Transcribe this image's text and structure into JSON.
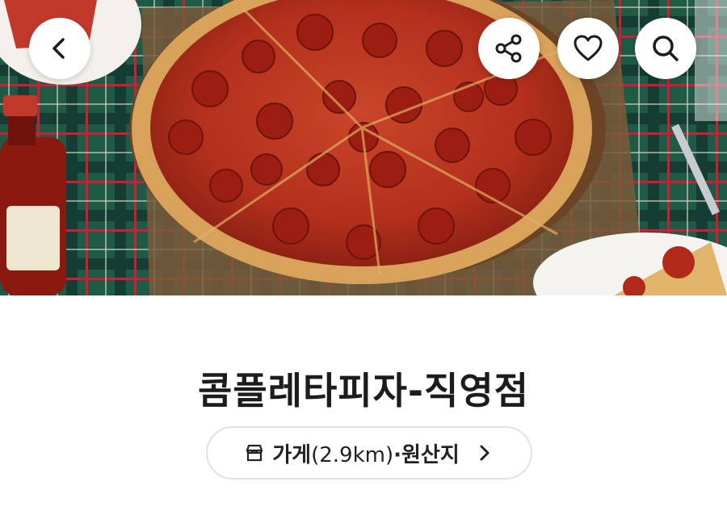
{
  "store": {
    "name": "콤플레타피자-직영점",
    "info_link": {
      "prefix": "가게",
      "distance": "(2.9km)",
      "suffix": "·원산지"
    }
  },
  "header": {
    "icons": {
      "back": "chevron-left-icon",
      "share": "share-icon",
      "favorite": "heart-icon",
      "search": "search-icon",
      "store": "store-icon",
      "more": "chevron-right-icon"
    }
  },
  "colors": {
    "text_primary": "#1c1c1c",
    "pill_border": "#e2e2e2",
    "tablecloth": "#1f5a45",
    "pizza_sauce": "#b8281a"
  }
}
